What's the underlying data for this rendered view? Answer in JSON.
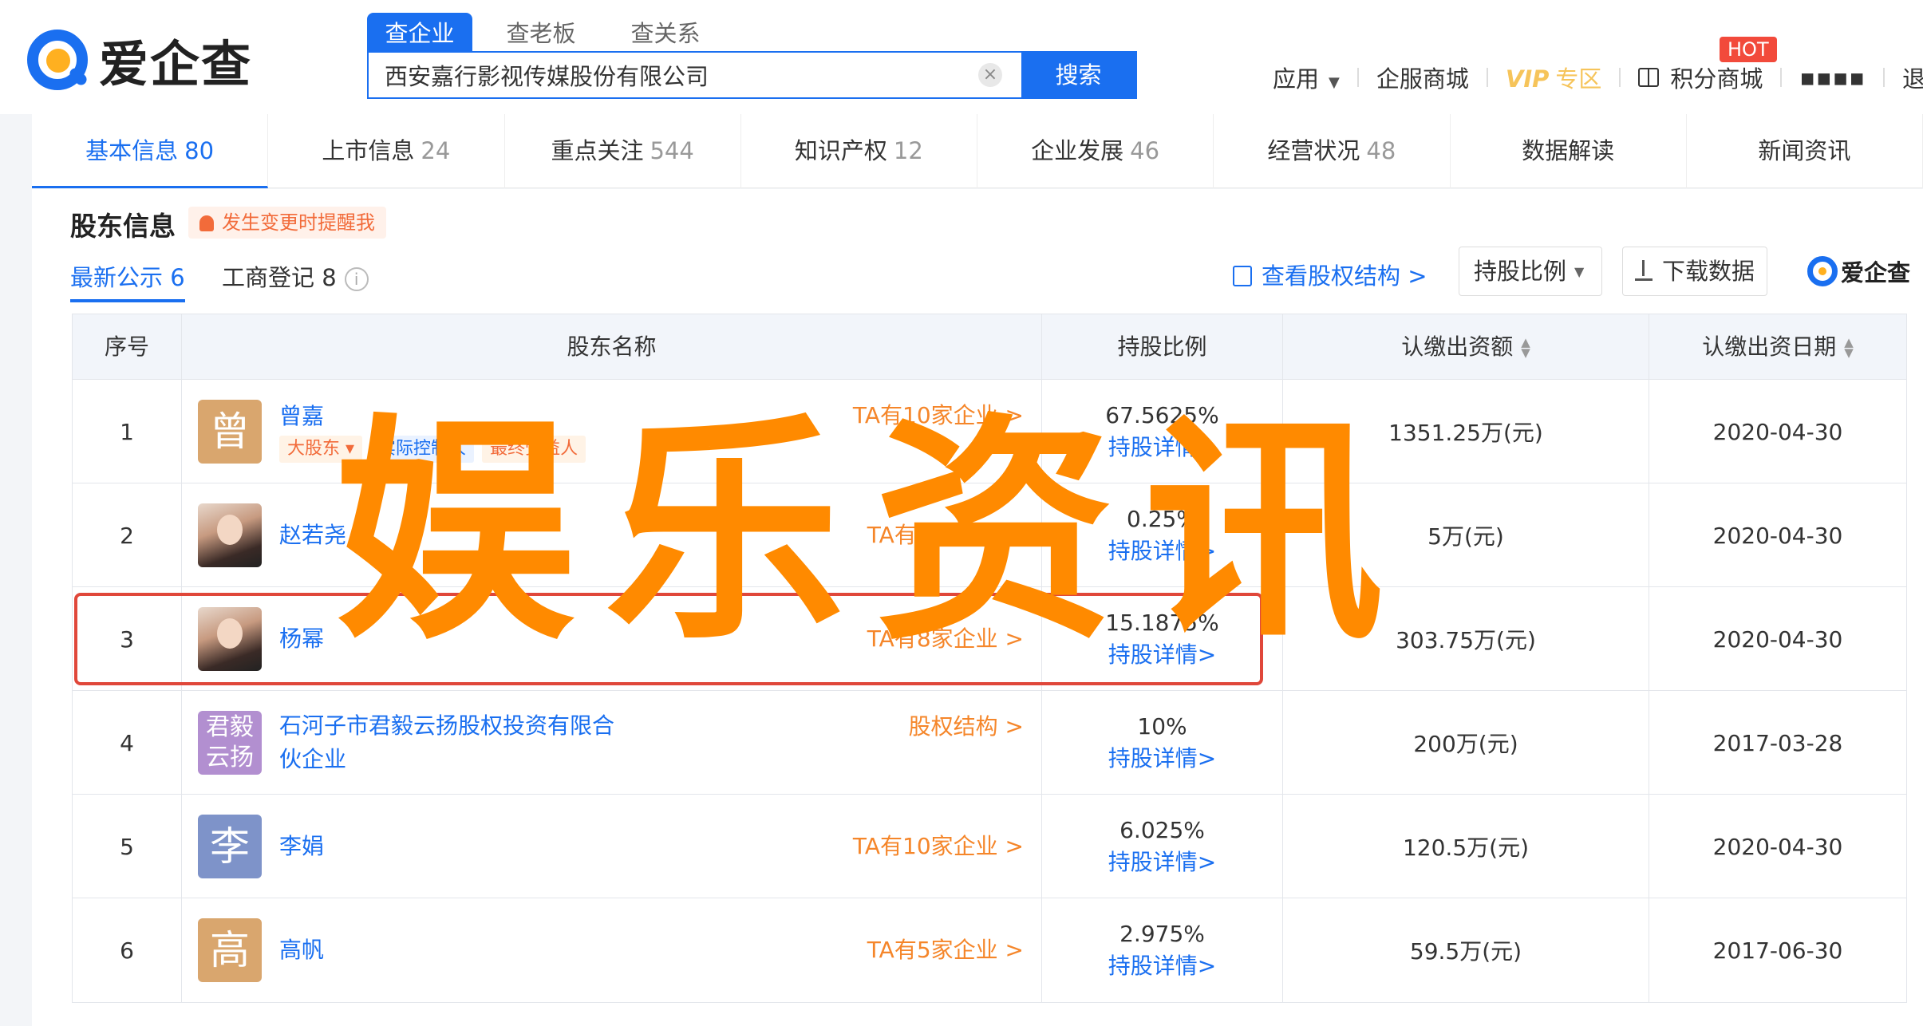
{
  "header": {
    "logo_text": "爱企查",
    "search_tabs": [
      {
        "label": "查企业",
        "active": true
      },
      {
        "label": "查老板",
        "active": false
      },
      {
        "label": "查关系",
        "active": false
      }
    ],
    "search_value": "西安嘉行影视传媒股份有限公司",
    "search_button": "搜索",
    "clear_icon": "×",
    "nav": {
      "apps": "应用",
      "apps_caret": "▼",
      "mall": "企服商城",
      "vip": "VIP",
      "vip_zone": "专区",
      "points": "积分商城",
      "hot": "HOT",
      "user": "▪︎▪︎▪︎▪︎",
      "logout": "退出"
    }
  },
  "category_tabs": [
    {
      "label": "基本信息",
      "count": "80",
      "active": true
    },
    {
      "label": "上市信息",
      "count": "24",
      "active": false
    },
    {
      "label": "重点关注",
      "count": "544",
      "active": false
    },
    {
      "label": "知识产权",
      "count": "12",
      "active": false
    },
    {
      "label": "企业发展",
      "count": "46",
      "active": false
    },
    {
      "label": "经营状况",
      "count": "48",
      "active": false
    },
    {
      "label": "数据解读",
      "count": "",
      "active": false
    },
    {
      "label": "新闻资讯",
      "count": "",
      "active": false
    }
  ],
  "section": {
    "title": "股东信息",
    "remind": "发生变更时提醒我",
    "sub_tabs": [
      {
        "label": "最新公示 6",
        "active": true
      },
      {
        "label": "工商登记 8",
        "active": false
      }
    ],
    "info_icon": "i",
    "equity_link": "查看股权结构 >",
    "ratio_select": "持股比例",
    "ratio_caret": "▼",
    "download": "下载数据",
    "mini_logo": "爱企查"
  },
  "table": {
    "headers": {
      "index": "序号",
      "name": "股东名称",
      "ratio": "持股比例",
      "amount": "认缴出资额",
      "date": "认缴出资日期"
    },
    "sort_icon": "▲▼",
    "rows": [
      {
        "index": "1",
        "avatar": "曾",
        "name": "曾嘉",
        "related": "TA有10家企业 >",
        "ratio": "67.5625%",
        "detail": "持股详情>",
        "amount": "1351.25万(元)",
        "date": "2020-04-30",
        "tags": [
          "大股东 ▾",
          "实际控制人",
          "最终受益人"
        ]
      },
      {
        "index": "2",
        "avatar": "",
        "name": "赵若尧",
        "related": "TA有3家企业 >",
        "ratio": "0.25%",
        "detail": "持股详情>",
        "amount": "5万(元)",
        "date": "2020-04-30",
        "tags": []
      },
      {
        "index": "3",
        "avatar": "",
        "name": "杨幂",
        "related": "TA有8家企业 >",
        "ratio": "15.1875%",
        "detail": "持股详情>",
        "amount": "303.75万(元)",
        "date": "2020-04-30",
        "tags": []
      },
      {
        "index": "4",
        "avatar": "君毅云扬",
        "name": "石河子市君毅云扬股权投资有限合伙企业",
        "related": "股权结构 >",
        "ratio": "10%",
        "detail": "持股详情>",
        "amount": "200万(元)",
        "date": "2017-03-28",
        "tags": []
      },
      {
        "index": "5",
        "avatar": "李",
        "name": "李娟",
        "related": "TA有10家企业 >",
        "ratio": "6.025%",
        "detail": "持股详情>",
        "amount": "120.5万(元)",
        "date": "2020-04-30",
        "tags": []
      },
      {
        "index": "6",
        "avatar": "高",
        "name": "高帆",
        "related": "TA有5家企业 >",
        "ratio": "2.975%",
        "detail": "持股详情>",
        "amount": "59.5万(元)",
        "date": "2017-06-30",
        "tags": []
      }
    ]
  },
  "watermark": "娱乐资讯",
  "colors": {
    "brand": "#1a6ff0",
    "accent_orange": "#f5862a",
    "watermark": "#ff8a00",
    "highlight": "#e0473a",
    "avatar_zeng": "#d9a66e",
    "avatar_junyi": "#b28fd0",
    "avatar_li": "#7e93c9",
    "avatar_gao": "#d9a66e"
  }
}
